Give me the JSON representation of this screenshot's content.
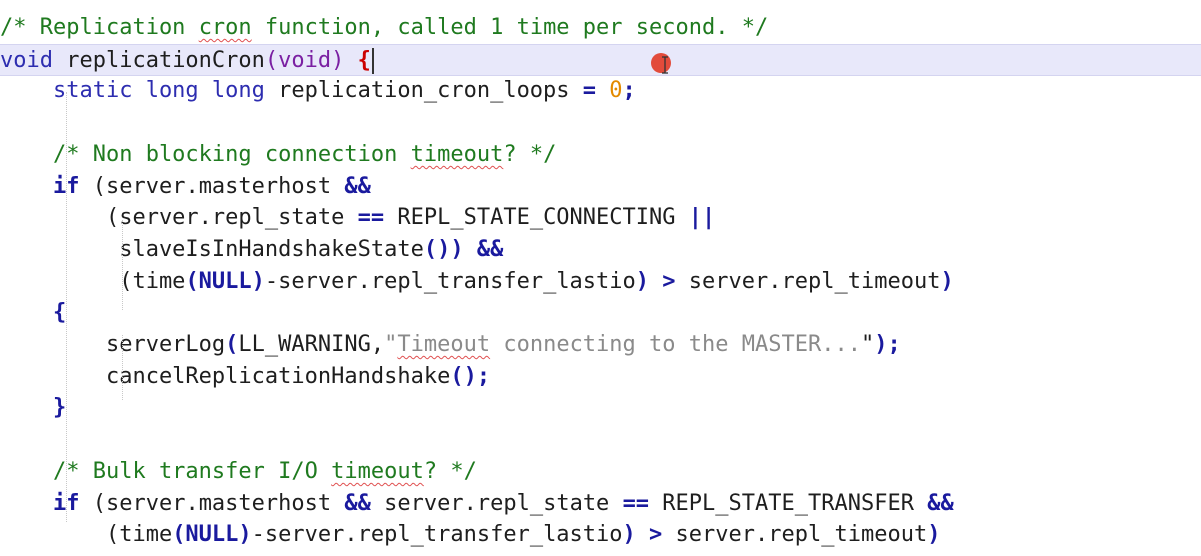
{
  "editor": {
    "lines": [
      {
        "tokens": [
          {
            "t": "/* Replication ",
            "c": "comment"
          },
          {
            "t": "cron",
            "c": "comment squiggle"
          },
          {
            "t": " function, called 1 time per second. */",
            "c": "comment"
          }
        ]
      },
      {
        "tokens": [
          {
            "t": "void",
            "c": "kw"
          },
          {
            "t": " replicationCron",
            "c": "plain"
          },
          {
            "t": "(void)",
            "c": "paren"
          },
          {
            "t": " ",
            "c": "plain"
          },
          {
            "t": "{",
            "c": "brace-match"
          }
        ]
      },
      {
        "tokens": [
          {
            "t": "    static long long",
            "c": "kw"
          },
          {
            "t": " replication_cron_loops ",
            "c": "plain"
          },
          {
            "t": "=",
            "c": "op"
          },
          {
            "t": " ",
            "c": "plain"
          },
          {
            "t": "0",
            "c": "num"
          },
          {
            "t": ";",
            "c": "op"
          }
        ]
      },
      {
        "tokens": []
      },
      {
        "tokens": [
          {
            "t": "    /* Non blocking connection ",
            "c": "comment"
          },
          {
            "t": "timeout",
            "c": "comment squiggle"
          },
          {
            "t": "? */",
            "c": "comment"
          }
        ]
      },
      {
        "tokens": [
          {
            "t": "    ",
            "c": "plain"
          },
          {
            "t": "if",
            "c": "kwb"
          },
          {
            "t": " (server.masterhost ",
            "c": "plain"
          },
          {
            "t": "&&",
            "c": "op"
          }
        ]
      },
      {
        "tokens": [
          {
            "t": "        (server.repl_state ",
            "c": "plain"
          },
          {
            "t": "==",
            "c": "op"
          },
          {
            "t": " REPL_STATE_CONNECTING ",
            "c": "plain"
          },
          {
            "t": "||",
            "c": "op"
          }
        ]
      },
      {
        "tokens": [
          {
            "t": "         slaveIsInHandshakeState",
            "c": "plain"
          },
          {
            "t": "())",
            "c": "op"
          },
          {
            "t": " ",
            "c": "plain"
          },
          {
            "t": "&&",
            "c": "op"
          }
        ]
      },
      {
        "tokens": [
          {
            "t": "         (time",
            "c": "plain"
          },
          {
            "t": "(NULL)",
            "c": "op"
          },
          {
            "t": "-server.repl_transfer_lastio",
            "c": "plain"
          },
          {
            "t": ")",
            "c": "op"
          },
          {
            "t": " ",
            "c": "plain"
          },
          {
            "t": ">",
            "c": "op"
          },
          {
            "t": " server.repl_timeout",
            "c": "plain"
          },
          {
            "t": ")",
            "c": "op"
          }
        ]
      },
      {
        "tokens": [
          {
            "t": "    ",
            "c": "plain"
          },
          {
            "t": "{",
            "c": "op"
          }
        ]
      },
      {
        "tokens": [
          {
            "t": "        serverLog",
            "c": "plain"
          },
          {
            "t": "(",
            "c": "op"
          },
          {
            "t": "LL_WARNING,",
            "c": "plain"
          },
          {
            "t": "\"",
            "c": "str"
          },
          {
            "t": "Timeout",
            "c": "str squiggle"
          },
          {
            "t": " connecting to the MASTER...",
            "c": "str"
          },
          {
            "t": "\"",
            "c": "plain"
          },
          {
            "t": ");",
            "c": "op"
          }
        ]
      },
      {
        "tokens": [
          {
            "t": "        cancelReplicationHandshake",
            "c": "plain"
          },
          {
            "t": "();",
            "c": "op"
          }
        ]
      },
      {
        "tokens": [
          {
            "t": "    ",
            "c": "plain"
          },
          {
            "t": "}",
            "c": "op"
          }
        ]
      },
      {
        "tokens": []
      },
      {
        "tokens": [
          {
            "t": "    /* Bulk transfer I/O ",
            "c": "comment"
          },
          {
            "t": "timeout",
            "c": "comment squiggle"
          },
          {
            "t": "? */",
            "c": "comment"
          }
        ]
      },
      {
        "tokens": [
          {
            "t": "    ",
            "c": "plain"
          },
          {
            "t": "if",
            "c": "kwb"
          },
          {
            "t": " (server.masterhost ",
            "c": "plain"
          },
          {
            "t": "&&",
            "c": "op"
          },
          {
            "t": " server.repl_state ",
            "c": "plain"
          },
          {
            "t": "==",
            "c": "op"
          },
          {
            "t": " REPL_STATE_TRANSFER ",
            "c": "plain"
          },
          {
            "t": "&&",
            "c": "op"
          }
        ]
      },
      {
        "tokens": [
          {
            "t": "        (time",
            "c": "plain"
          },
          {
            "t": "(NULL)",
            "c": "op"
          },
          {
            "t": "-server.repl_transfer_lastio",
            "c": "plain"
          },
          {
            "t": ")",
            "c": "op"
          },
          {
            "t": " ",
            "c": "plain"
          },
          {
            "t": ">",
            "c": "op"
          },
          {
            "t": " server.repl_timeout",
            "c": "plain"
          },
          {
            "t": ")",
            "c": "op"
          }
        ]
      }
    ],
    "current_line": 1,
    "colors": {
      "comment": "#1f7a1f",
      "keyword": "#2d2db0",
      "number": "#e38a00",
      "string": "#8a8a8a",
      "current_line_bg": "#e8e8fa",
      "brace_match": "#cc0000",
      "mouse_cursor": "#e24b3b"
    }
  }
}
